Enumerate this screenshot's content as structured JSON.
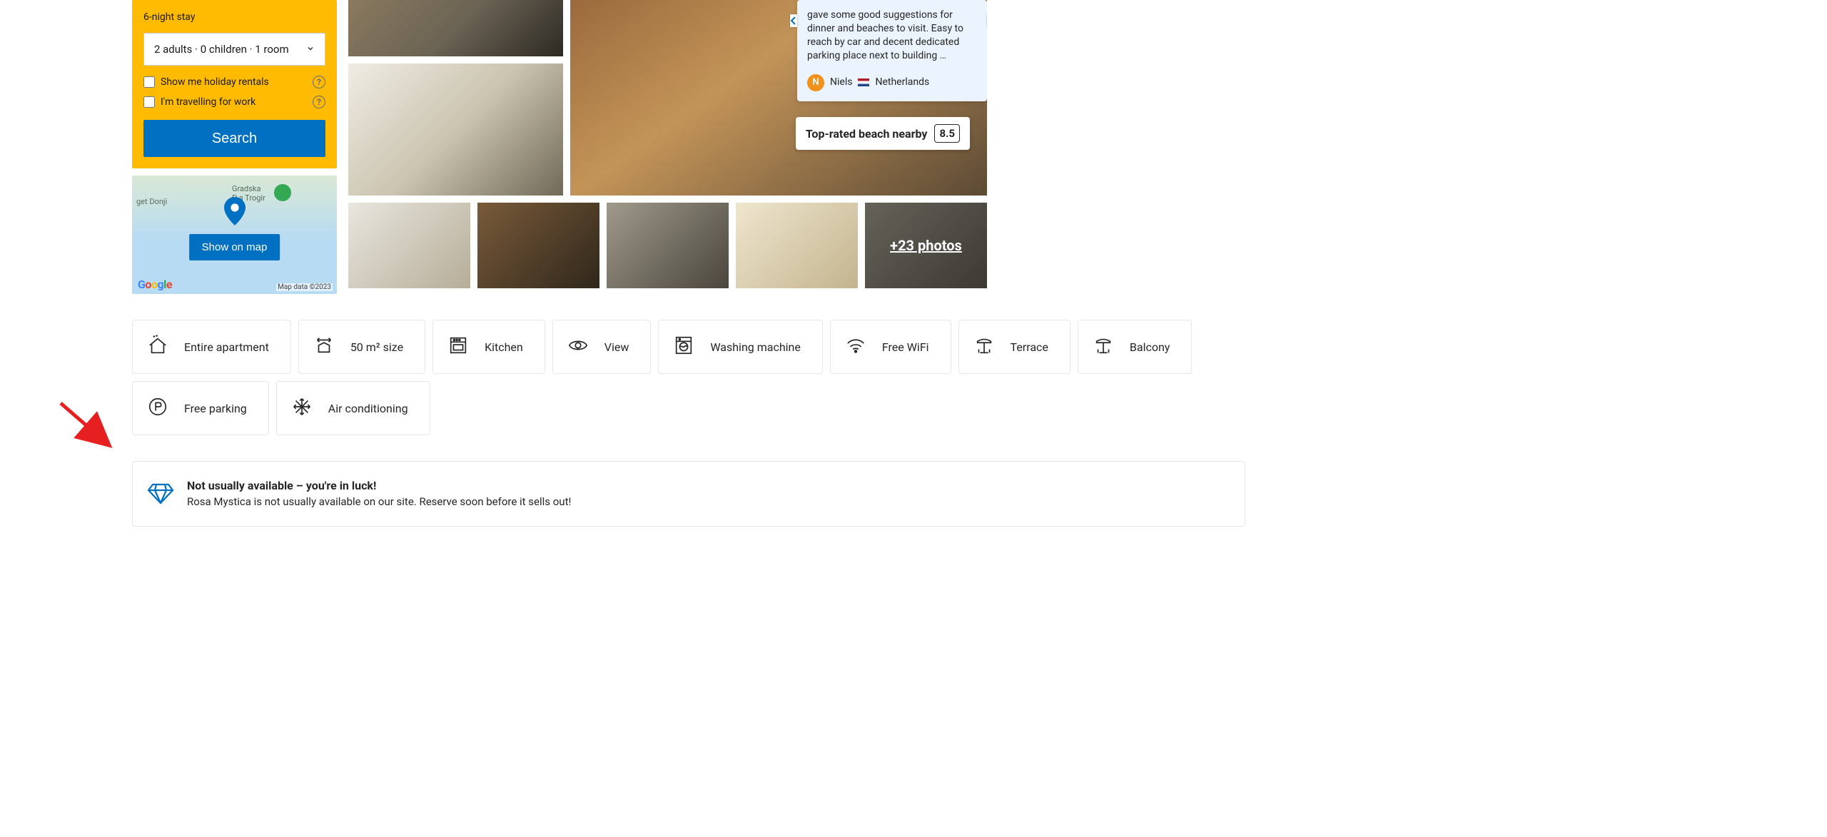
{
  "search": {
    "stay_label": "6-night stay",
    "guests_value": "2 adults · 0 children · 1 room",
    "checkbox_holiday": "Show me holiday rentals",
    "checkbox_work": "I'm travelling for work",
    "search_button": "Search"
  },
  "map": {
    "show_button": "Show on map",
    "attr": "Map data ©2023",
    "label_a": "get Donji",
    "label_b": "Gradska\nP    a Trogir"
  },
  "review": {
    "snippet": "gave some good suggestions for dinner and beaches to visit. Easy to reach by car and decent dedicated parking place next to building …",
    "author_initial": "N",
    "author_name": "Niels",
    "author_country": "Netherlands"
  },
  "beach": {
    "label": "Top-rated beach nearby",
    "score": "8.5"
  },
  "thumbs": {
    "more_label": "+23 photos"
  },
  "amenities": [
    {
      "key": "apartment",
      "label": "Entire apartment"
    },
    {
      "key": "size",
      "label": "50 m² size"
    },
    {
      "key": "kitchen",
      "label": "Kitchen"
    },
    {
      "key": "view",
      "label": "View"
    },
    {
      "key": "washing",
      "label": "Washing machine"
    },
    {
      "key": "wifi",
      "label": "Free WiFi"
    },
    {
      "key": "terrace",
      "label": "Terrace"
    },
    {
      "key": "balcony",
      "label": "Balcony"
    },
    {
      "key": "parking",
      "label": "Free parking"
    },
    {
      "key": "ac",
      "label": "Air conditioning"
    }
  ],
  "lucky": {
    "title": "Not usually available – you're in luck!",
    "subtitle": "Rosa Mystica is not usually available on our site. Reserve soon before it sells out!"
  }
}
